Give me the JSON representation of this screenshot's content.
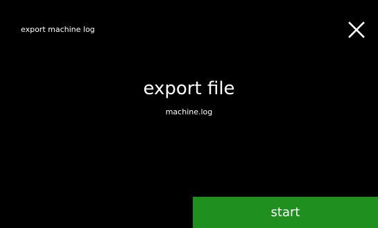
{
  "header": {
    "title": "export machine log",
    "close_icon": "close-icon"
  },
  "main": {
    "title": "export file",
    "file_name": "machine.log"
  },
  "footer": {
    "start_label": "start"
  },
  "colors": {
    "background": "#000000",
    "text": "#ffffff",
    "start_button": "#1f8f1f"
  }
}
